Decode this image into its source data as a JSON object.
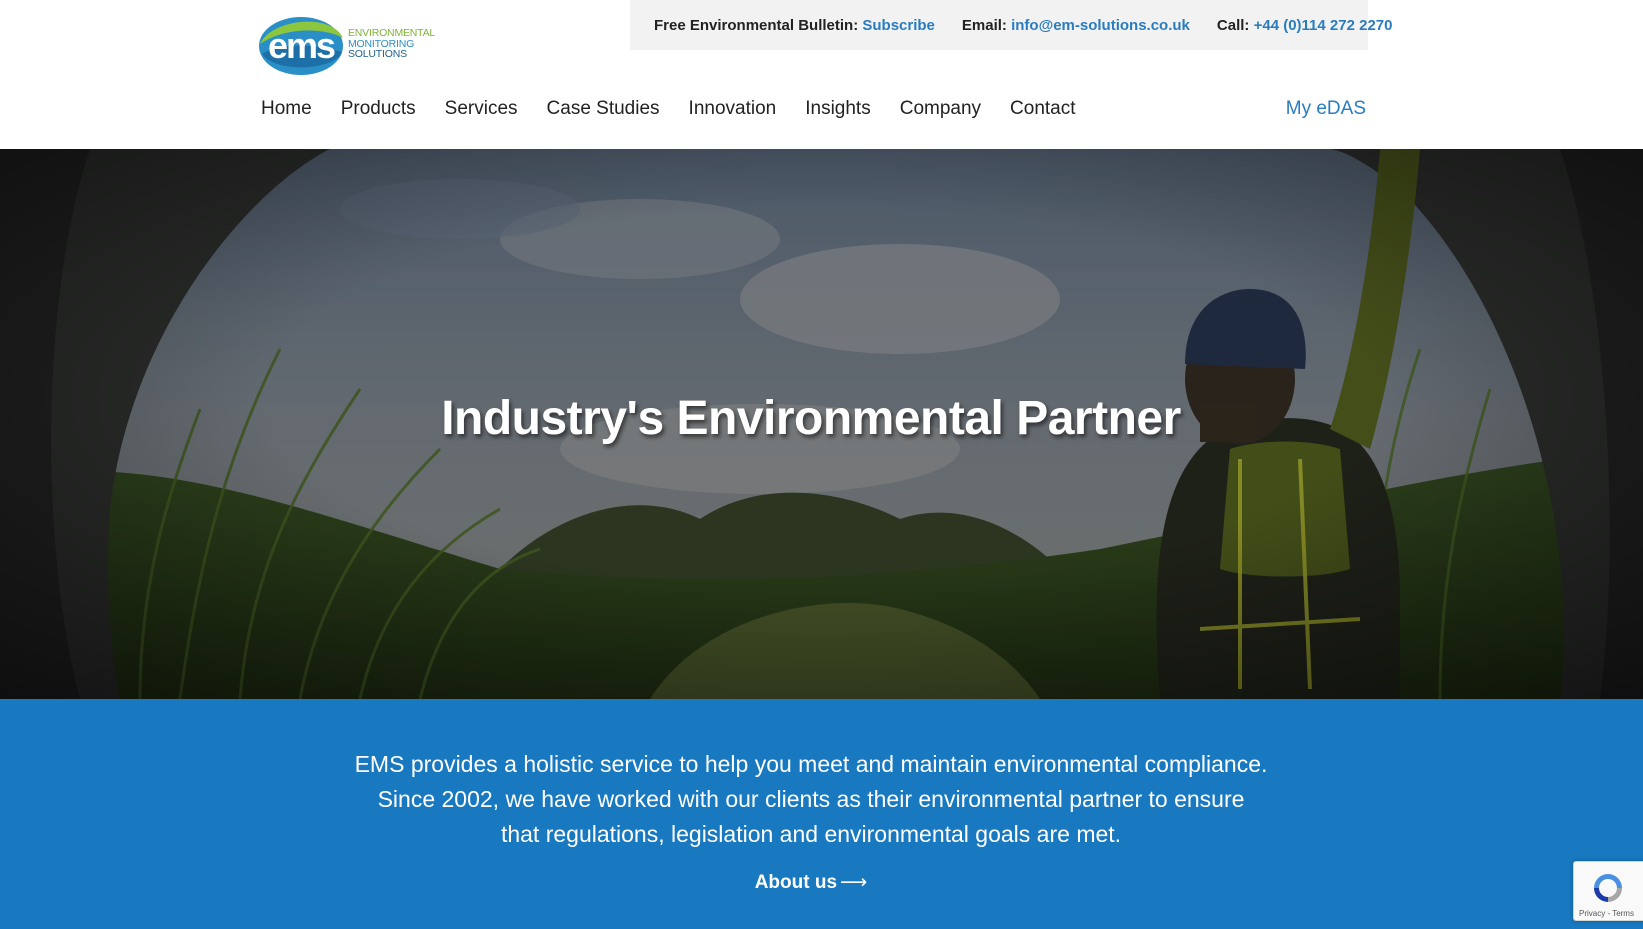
{
  "logo": {
    "name": "ems-logo",
    "mark_text": "ems",
    "line1": "ENVIRONMENTAL",
    "line2": "MONITORING",
    "line3": "SOLUTIONS"
  },
  "topbar": {
    "bulletin_label": "Free Environmental Bulletin:",
    "bulletin_link": "Subscribe",
    "email_label": "Email:",
    "email_link": "info@em-solutions.co.uk",
    "call_label": "Call:",
    "call_link": "+44 (0)114 272 2270"
  },
  "nav": {
    "items": [
      "Home",
      "Products",
      "Services",
      "Case Studies",
      "Innovation",
      "Insights",
      "Company",
      "Contact"
    ],
    "edas": "My eDAS"
  },
  "hero": {
    "title": "Industry's Environmental Partner"
  },
  "intro": {
    "line1": "EMS provides a holistic service to help you meet and maintain environmental compliance.",
    "line2": "Since 2002, we have worked with our clients as their environmental partner to ensure",
    "line3": "that regulations, legislation and environmental goals are met.",
    "about_label": "About us",
    "about_arrow": "⟶"
  },
  "recaptcha": {
    "links": "Privacy - Terms"
  },
  "colors": {
    "link_blue": "#2a7cc0",
    "intro_bg": "#1879c1",
    "topbar_bg": "#f2f2f2",
    "logo_green": "#7fb33a",
    "logo_blue": "#2a8fc6"
  }
}
